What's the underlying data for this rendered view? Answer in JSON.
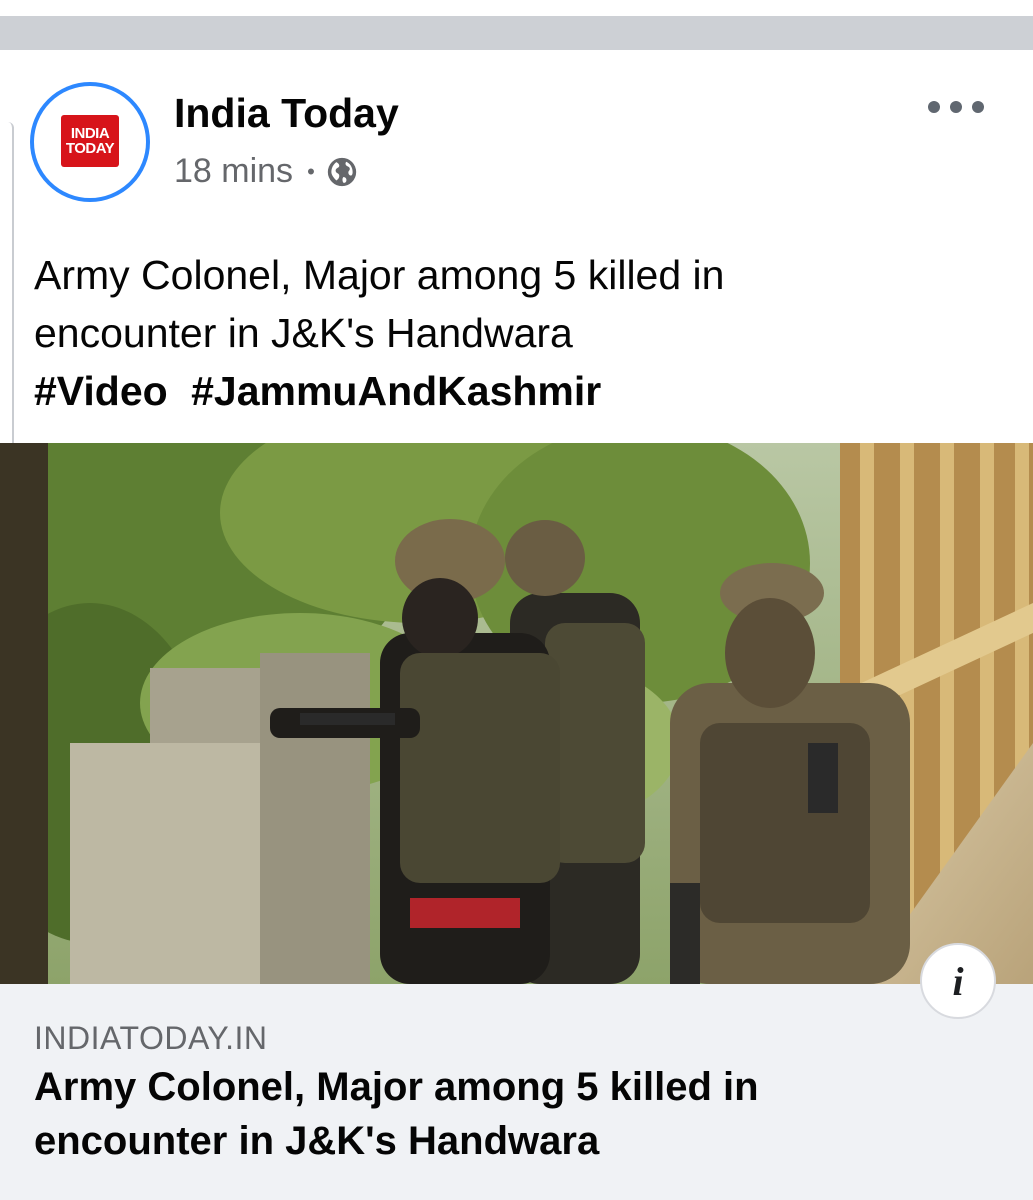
{
  "post": {
    "page_name": "India Today",
    "time": "18 mins",
    "separator": "•",
    "privacy_icon": "globe-icon",
    "more_icon": "more-options-icon",
    "text_line1": "Army Colonel, Major among 5 killed in",
    "text_line2": "encounter in J&K's Handwara",
    "hashtags": [
      "#Video",
      "#JammuAndKashmir"
    ]
  },
  "avatar": {
    "logo_line1": "INDIA",
    "logo_line2": "TODAY",
    "ring_color": "#2d88ff",
    "logo_color": "#d7141a"
  },
  "link_preview": {
    "domain": "INDIATODAY.IN",
    "title_line1": "Army Colonel, Major among 5 killed in",
    "title_line2": "encounter in J&K's Handwara",
    "info_label": "i"
  },
  "colors": {
    "text": "#050505",
    "meta": "#65676b",
    "preview_bg": "#f0f2f5"
  }
}
